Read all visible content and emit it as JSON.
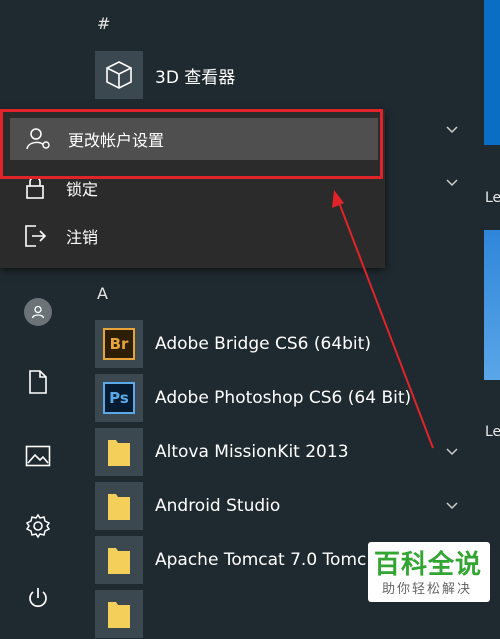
{
  "sections": {
    "hash": "#",
    "a": "A"
  },
  "apps": [
    {
      "label": "3D 查看器",
      "icon": "cube-icon"
    },
    {
      "label": "Adobe Bridge CS6 (64bit)",
      "icon": "br",
      "icon_text": "Br",
      "color": "#e8a33a"
    },
    {
      "label": "Adobe Photoshop CS6 (64 Bit)",
      "icon": "ps",
      "icon_text": "Ps",
      "color": "#5aa8e6"
    },
    {
      "label": "Altova MissionKit 2013",
      "icon": "folder-icon"
    },
    {
      "label": "Android Studio",
      "icon": "folder-icon"
    },
    {
      "label": "Apache Tomcat 7.0 Tomc",
      "icon": "folder-icon"
    }
  ],
  "account_menu": {
    "change_settings": "更改帐户设置",
    "lock": "锁定",
    "sign_out": "注销"
  },
  "tiles": {
    "t1": "Le",
    "t2": "Le"
  },
  "watermark": {
    "title": "百科全说",
    "subtitle": "助你轻松解决"
  },
  "colors": {
    "highlight_border": "#e0242a",
    "folder": "#f4cf5a"
  }
}
